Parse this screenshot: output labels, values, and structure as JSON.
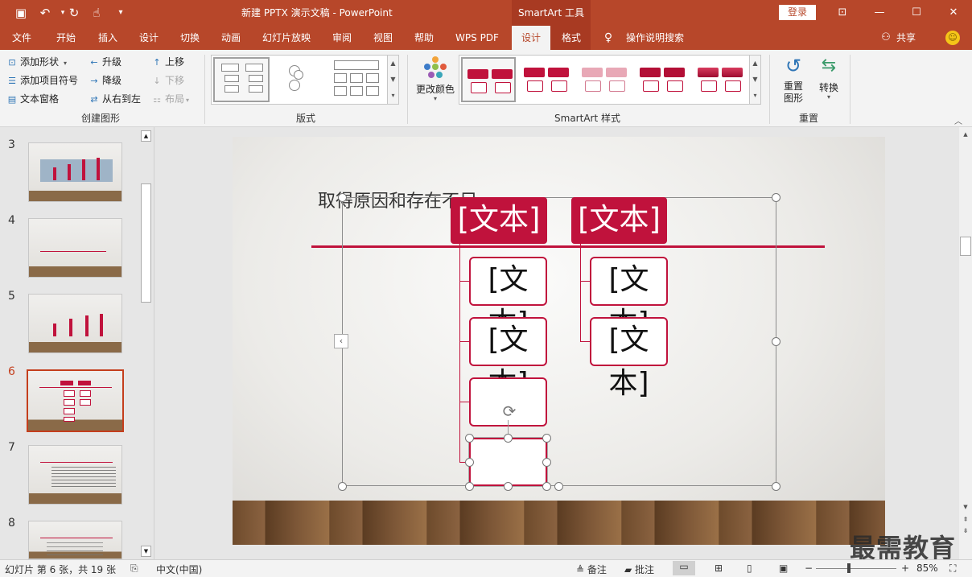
{
  "window": {
    "doc_title": "新建 PPTX 演示文稿  -  PowerPoint",
    "context_title": "SmartArt 工具",
    "login": "登录"
  },
  "quick_access": [
    "save-icon",
    "undo-icon",
    "redo-icon",
    "touch-mode-icon",
    "customize-icon"
  ],
  "tabs": [
    "文件",
    "开始",
    "插入",
    "设计",
    "切换",
    "动画",
    "幻灯片放映",
    "审阅",
    "视图",
    "帮助",
    "WPS PDF",
    "设计",
    "格式"
  ],
  "active_tab": "设计",
  "tell_me": "操作说明搜索",
  "share": "共享",
  "ribbon": {
    "create": {
      "add_shape": "添加形状",
      "add_bullet": "添加项目符号",
      "text_pane": "文本窗格",
      "promote": "升级",
      "demote": "降级",
      "rtl": "从右到左",
      "move_up": "上移",
      "move_down": "下移",
      "layout": "布局",
      "label": "创建图形"
    },
    "layouts": {
      "label": "版式"
    },
    "styles": {
      "change_color": "更改颜色",
      "label": "SmartArt 样式"
    },
    "reset": {
      "reset_graphic": "重置\n图形",
      "convert": "转换",
      "label": "重置"
    }
  },
  "slides": [
    {
      "num": "3"
    },
    {
      "num": "4"
    },
    {
      "num": "5"
    },
    {
      "num": "6"
    },
    {
      "num": "7"
    },
    {
      "num": "8"
    }
  ],
  "current_slide": "6",
  "slide": {
    "title": "取得原因和存在不足",
    "smartart": {
      "left_header": "[文本]",
      "right_header": "[文本]",
      "left_items": [
        "[文本]",
        "[文本]",
        "",
        ""
      ],
      "right_items": [
        "[文本]",
        "[文本]"
      ]
    }
  },
  "status": {
    "slide_info": "幻灯片 第 6 张，共 19 张",
    "language": "中文(中国)",
    "notes": "备注",
    "comments": "批注",
    "zoom": "85%",
    "zoom_level": 0.85
  },
  "watermark": "最需教育",
  "colors": {
    "brand": "#b7472a",
    "accent": "#c0123c"
  }
}
